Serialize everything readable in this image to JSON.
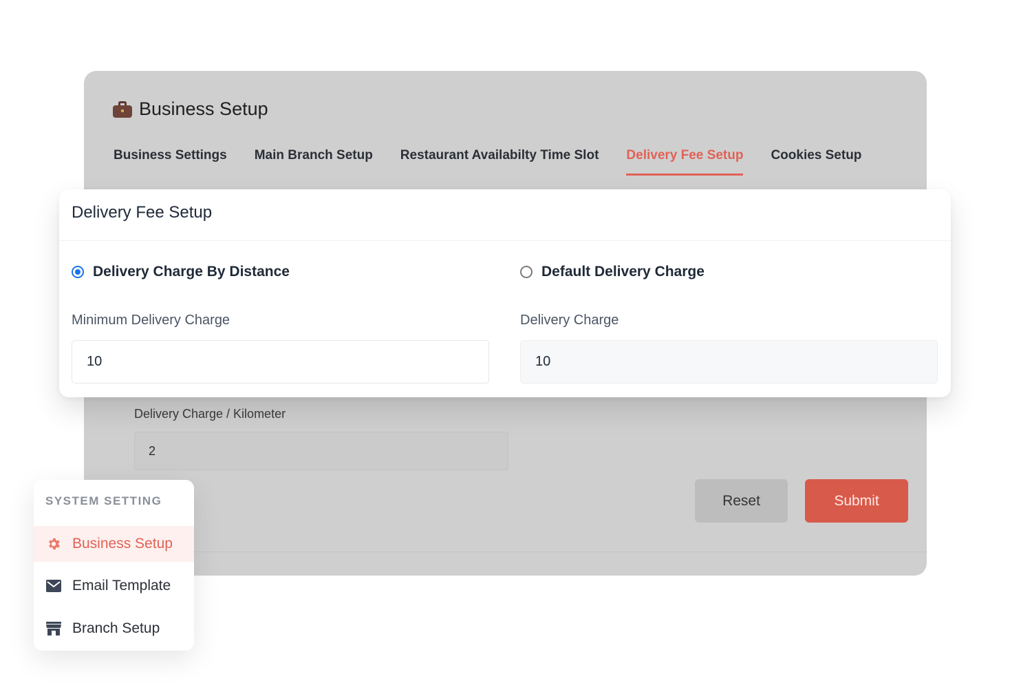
{
  "background_panel": {
    "title": "Business Setup",
    "icon": "briefcase-icon",
    "tabs": [
      {
        "label": "Business Settings",
        "active": false
      },
      {
        "label": "Main Branch Setup",
        "active": false
      },
      {
        "label": "Restaurant Availabilty Time Slot",
        "active": false
      },
      {
        "label": "Delivery Fee Setup",
        "active": true
      },
      {
        "label": "Cookies Setup",
        "active": false
      }
    ],
    "per_km_label": "Delivery Charge / Kilometer",
    "per_km_value": "2",
    "reset_label": "Reset",
    "submit_label": "Submit"
  },
  "card": {
    "title": "Delivery Fee Setup",
    "option_distance": "Delivery Charge By Distance",
    "option_default": "Default Delivery Charge",
    "selected_option": "distance",
    "min_charge_label": "Minimum Delivery Charge",
    "min_charge_value": "10",
    "delivery_charge_label": "Delivery Charge",
    "delivery_charge_value": "10"
  },
  "sidebar": {
    "heading": "SYSTEM SETTING",
    "items": [
      {
        "label": "Business Setup",
        "icon": "gear-icon",
        "active": true
      },
      {
        "label": "Email Template",
        "icon": "envelope-icon",
        "active": false
      },
      {
        "label": "Branch Setup",
        "icon": "store-icon",
        "active": false
      }
    ]
  },
  "colors": {
    "accent": "#e06256",
    "radio_checked": "#1a73e8",
    "panel_dim": "#cfcfcf"
  }
}
